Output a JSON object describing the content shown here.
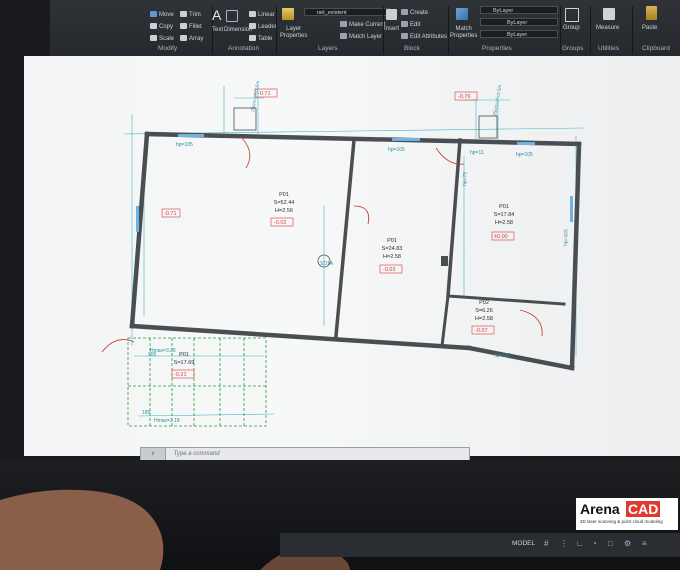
{
  "ribbon": {
    "modify": {
      "items": [
        "Move",
        "Trim",
        "Fillet",
        "Copy",
        "Mirror",
        "Stretch",
        "Scale",
        "Array"
      ],
      "label": "Modify"
    },
    "annotation": {
      "text": "Text",
      "dimension": "Dimension",
      "linear": "Linear",
      "leader": "Leader",
      "table": "Table",
      "label": "Annotation"
    },
    "layers": {
      "layer_properties": "Layer\nProperties",
      "current_layer": "net_existent",
      "make_current": "Make Current",
      "match_layer": "Match Layer",
      "label": "Layers"
    },
    "block": {
      "insert": "Insert",
      "create": "Create",
      "edit": "Edit",
      "edit_attributes": "Edit Attributes",
      "label": "Block"
    },
    "properties": {
      "match_properties": "Match\nProperties",
      "color": "ByLayer",
      "linetype": "ByLayer",
      "lineweight": "ByLayer",
      "label": "Properties"
    },
    "groups": {
      "group": "Group",
      "label": "Groups"
    },
    "utilities": {
      "measure": "Measure",
      "label": "Utilities"
    },
    "clipboard": {
      "paste": "Paste",
      "label": "Clipboard"
    }
  },
  "drawing": {
    "room_p01_main": {
      "name": "P01",
      "area": "S=52.44",
      "height": "H=2.56",
      "level": "-0.02"
    },
    "room_p01_center": {
      "name": "P01",
      "area": "S=24.83",
      "height": "H=2.58",
      "level": "-0.03"
    },
    "room_p01_right": {
      "name": "P01",
      "area": "S=17.84",
      "height": "H=2.58",
      "level": "±0.00"
    },
    "room_p02": {
      "name": "P02",
      "area": "S=6.26",
      "height": "H=2.58",
      "level": "-0.07"
    },
    "room_terrace": {
      "name": "P01",
      "area": "S=17.69",
      "level": "-0.21"
    },
    "dims": {
      "hp105_a": "hp=105",
      "hp105_b": "hp=105",
      "hp11": "hp=11",
      "hp105_c": "hp=105",
      "hp105_right": "hp=105",
      "hp165": "hp=165",
      "hp75": "hp=75",
      "hmax_a": "Hmax=3.26",
      "hmax_b": "Hmax=2.18",
      "d205": "205",
      "d185": "185",
      "d_vert": "25cm=1%/2.5m",
      "d_vert2": "25cm=1%/2.5m",
      "sd": "SD1A"
    },
    "levels": {
      "top_left": "-0.71",
      "top_right": "-0.76",
      "left_wall": "-0.71"
    }
  },
  "command_line": {
    "placeholder": "Type a command"
  },
  "status": {
    "model": "MODEL"
  },
  "logo": {
    "brand_a": "Arena",
    "brand_b": "CAD",
    "tagline": "3D laser scanning & point cloud modeling"
  },
  "colors": {
    "wall": "#4a4d52",
    "dimension": "#3fb7c9",
    "label_red": "#d93a3a",
    "accent": "#e03a2f",
    "ribbon": "#2b2e32"
  }
}
